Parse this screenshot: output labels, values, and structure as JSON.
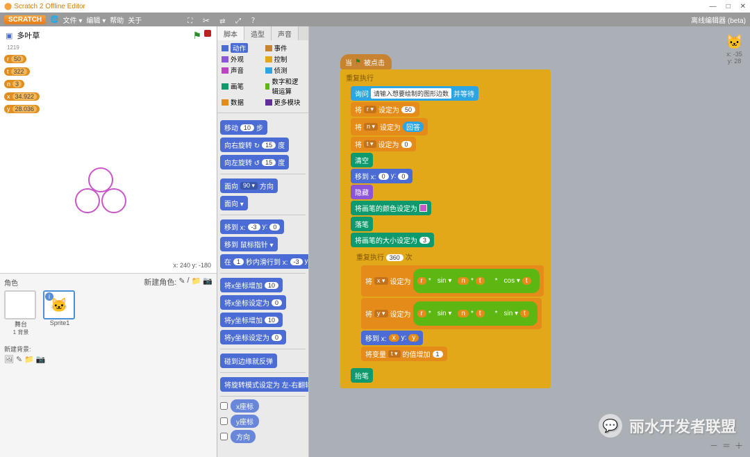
{
  "window": {
    "title": "Scratch 2 Offline Editor",
    "min": "—",
    "max": "□",
    "close": "✕"
  },
  "menu": {
    "logo": "SCRATCH",
    "globe": "🌐",
    "file": "文件 ▾",
    "edit": "编辑 ▾",
    "help": "帮助",
    "about": "关于",
    "offline": "离线编辑器 (beta)"
  },
  "stage": {
    "icon": "▣",
    "title": "多叶草",
    "s1": "1219",
    "vars": [
      {
        "n": "r",
        "v": "50"
      },
      {
        "n": "t",
        "v": "322"
      },
      {
        "n": "n",
        "v": "3"
      },
      {
        "n": "x",
        "v": "34.922"
      },
      {
        "n": "y",
        "v": "28.036"
      }
    ],
    "coords": "x: 240  y: -180",
    "spritesLabel": "角色",
    "newSprite": "新建角色:",
    "stageThumb": "舞台",
    "stageSub": "1 背景",
    "sprite1": "Sprite1",
    "newBg": "新建背景:"
  },
  "tabs": {
    "scripts": "脚本",
    "costumes": "造型",
    "sounds": "声音"
  },
  "cats": [
    {
      "n": "动作",
      "c": "#4a6cd4",
      "sel": true
    },
    {
      "n": "事件",
      "c": "#c88330"
    },
    {
      "n": "外观",
      "c": "#8a55d7"
    },
    {
      "n": "控制",
      "c": "#e1a91a"
    },
    {
      "n": "声音",
      "c": "#bb42c3"
    },
    {
      "n": "侦测",
      "c": "#2ca5e2"
    },
    {
      "n": "画笔",
      "c": "#0e9a6c"
    },
    {
      "n": "数字和逻辑运算",
      "c": "#5cb712"
    },
    {
      "n": "数据",
      "c": "#e58b1a"
    },
    {
      "n": "更多模块",
      "c": "#632d99"
    }
  ],
  "pal": {
    "move": "移动",
    "steps": "步",
    "turnR": "向右旋转 ↻",
    "turnL": "向左旋转 ↺",
    "deg": "度",
    "point": "面向",
    "dir": "方向",
    "pointTo": "面向 ▾",
    "gotoXY": "移到 x:",
    "gotoM": "移到 鼠标指针 ▾",
    "glide": "在",
    "glide2": "秒内滑行到 x:",
    "chgX": "将x坐标增加",
    "setX": "将x坐标设定为",
    "chgY": "将y坐标增加",
    "setY": "将y坐标设定为",
    "bounce": "碰到边缘就反弹",
    "rotStyle": "将旋转模式设定为 左-右翻转 ▾",
    "xpos": "x座标",
    "ypos": "y座标",
    "direction": "方向",
    "v10": "10",
    "v15": "15",
    "v90": "90 ▾",
    "vn3": "-3",
    "v0": "0",
    "v1": "1"
  },
  "script": {
    "hat": "当",
    "hatEnd": "被点击",
    "flag": "🏳",
    "forever": "重复执行",
    "ask": "询问",
    "askTxt": "请输入想要绘制的图形边数",
    "wait": "并等待",
    "set": "将",
    "setTo": "设定为",
    "answer": "回答",
    "r": "r ▾",
    "n": "n ▾",
    "t": "t ▾",
    "x": "x ▾",
    "y": "y ▾",
    "v50": "50",
    "v0": "0",
    "v3": "3",
    "v360": "360",
    "v1": "1",
    "clear": "清空",
    "gotoXY": "移到 x:",
    "hide": "隐藏",
    "penColor": "将画笔的颜色设定为",
    "penDown": "落笔",
    "penSize": "将画笔的大小设定为",
    "repeat": "重复执行",
    "times": "次",
    "rv": "r",
    "nv": "n",
    "tv": "t",
    "sin": "sin ▾",
    "cos": "cos ▾",
    "mul": "*",
    "gotoXv": "移到 x:",
    "yLbl": "y:",
    "xVar": "x",
    "yVar": "y",
    "chgVar": "将变量",
    "chgBy": "的值增加",
    "penUp": "抬笔"
  },
  "catpos": {
    "x": "x: -35",
    "y": "y: 28"
  },
  "zoom": {
    "in": "＋",
    "eq": "＝",
    "out": "－"
  },
  "watermark": "丽水开发者联盟"
}
